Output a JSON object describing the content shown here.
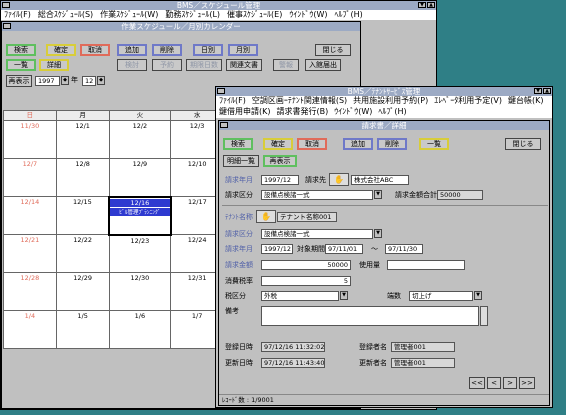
{
  "main": {
    "title": "BMS／スケジュール管理",
    "menu": [
      "ﾌｧｲﾙ(F)",
      "総合ｽｹｼﾞｭｰﾙ(S)",
      "作業ｽｹｼﾞｭｰﾙ(W)",
      "勤務ｽｹｼﾞｭｰﾙ(L)",
      "催事ｽｹｼﾞｭｰﾙ(E)",
      "ｳｲﾝﾄﾞｳ(W)",
      "ﾍﾙﾌﾟ(H)"
    ]
  },
  "schedule": {
    "title": "作業スケジュール／月別カレンダー",
    "buttons": [
      "検索",
      "確定",
      "取消",
      "追加",
      "削除",
      "日別",
      "月別",
      "閉じる",
      "一覧",
      "詳細",
      "検討",
      "予約",
      "期限日数",
      "関連文書",
      "警報",
      "入館届出"
    ],
    "redisplay": "再表示",
    "year": "1997",
    "year_unit": "年",
    "month": "12",
    "month_unit": "月",
    "weekdays": [
      "日",
      "月",
      "火",
      "水"
    ],
    "weeks": [
      [
        "11/30",
        "12/1",
        "12/2",
        "12/3"
      ],
      [
        "12/7",
        "12/8",
        "12/9",
        "12/10"
      ],
      [
        "12/14",
        "12/15",
        "12/16",
        "12/17"
      ],
      [
        "12/21",
        "12/22",
        "12/23",
        "12/24"
      ],
      [
        "12/28",
        "12/29",
        "12/30",
        "12/31"
      ],
      [
        "1/4",
        "1/5",
        "1/6",
        "1/7"
      ]
    ],
    "event": "ﾋﾞﾙ管理ﾌﾟﾗﾝﾆﾝｸﾞ"
  },
  "tenant": {
    "title": "BMS／ﾃﾅﾝﾄｻｰﾋﾞｽ管理",
    "menu": [
      "ﾌｧｲﾙ(F)",
      "空調区画ｰﾃﾅﾝﾄ関連情報(S)",
      "共用施設利用予約(P)",
      "ｴﾚﾍﾞｰﾀ利用予定(V)",
      "鍵台帳(K)",
      "鍵借用申請(K)",
      "請求書発行(B)",
      "ｳｲﾝﾄﾞｳ(W)",
      "ﾍﾙﾌﾟ(H)"
    ]
  },
  "invoice": {
    "title": "請求書／詳細",
    "buttons": {
      "search": "検索",
      "confirm": "確定",
      "cancel": "取消",
      "add": "追加",
      "delete": "削除",
      "list": "一覧",
      "close": "閉じる",
      "details_list": "明細一覧",
      "redisplay": "再表示"
    },
    "labels": {
      "bill_month": "請求年月",
      "billing_to": "請求先",
      "bill_type": "請求区分",
      "total": "請求金額合計",
      "tenant_name": "ﾃﾅﾝﾄ名称",
      "bill_type2": "請求区分",
      "bill_month2": "請求年月",
      "period": "対象期間",
      "amount": "請求金額",
      "usage": "使用量",
      "tax_rate": "消費税率",
      "tax_type": "税区分",
      "rounding": "端数",
      "remarks": "備考",
      "reg_date": "登録日時",
      "reg_user": "登録者名",
      "upd_date": "更新日時",
      "upd_user": "更新者名",
      "tilde": "〜"
    },
    "values": {
      "bill_month": "1997/12",
      "billing_to": "株式会社ABC",
      "bill_type": "設備点検諸一式",
      "total": "50000",
      "tenant_name": "テナント名称001",
      "bill_type2": "設備点検諸一式",
      "bill_month2": "1997/12",
      "period_from": "97/11/01",
      "period_to": "97/11/30",
      "amount": "50000",
      "tax_rate": "5",
      "tax_type": "外税",
      "rounding": "切上げ",
      "reg_date": "97/12/16 11:32:02",
      "reg_user": "管理者001",
      "upd_date": "97/12/16 11:43:40",
      "upd_user": "管理者001"
    },
    "nav": [
      "<<",
      "<",
      ">",
      ">>"
    ],
    "record": "ﾚｺｰﾄﾞ数 : 1/9001"
  },
  "colors": {
    "desktop": "#2f7f86",
    "titlebar": "#9caac4",
    "green": "#5fbf5f",
    "red": "#e06b5a",
    "blue": "#6f79c8",
    "yellow": "#d8cd3a",
    "selected": "#2e3ad0"
  }
}
